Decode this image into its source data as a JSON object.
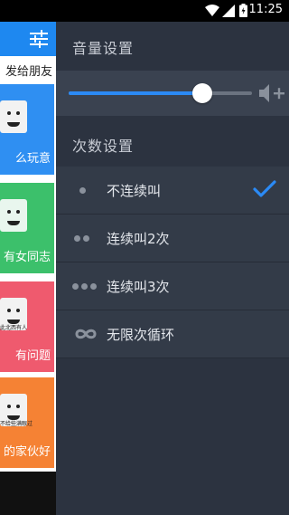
{
  "status_bar": {
    "time": "11:25"
  },
  "background_app": {
    "title_fragment": "发给朋友",
    "cards": [
      {
        "label": "么玩意",
        "color": "#2f8ff2",
        "caption": ""
      },
      {
        "label": "有女同志",
        "color": "#3cc06b",
        "caption": ""
      },
      {
        "label": "有问题",
        "color": "#ef5a6e",
        "caption": "此北西有人"
      },
      {
        "label": "的家伙好",
        "color": "#f58234",
        "caption": "不给些满眼过"
      }
    ]
  },
  "drawer": {
    "volume_section": {
      "title": "音量设置",
      "volume_level": 0.73
    },
    "count_section": {
      "title": "次数设置",
      "options": [
        {
          "label": "不连续叫",
          "icon": "one-dot-icon",
          "selected": true
        },
        {
          "label": "连续叫2次",
          "icon": "two-dots-icon",
          "selected": false
        },
        {
          "label": "连续叫3次",
          "icon": "three-dots-icon",
          "selected": false
        },
        {
          "label": "无限次循环",
          "icon": "infinity-icon",
          "selected": false
        }
      ]
    },
    "accent_color": "#2b8af5",
    "background_color": "#2c3340"
  }
}
